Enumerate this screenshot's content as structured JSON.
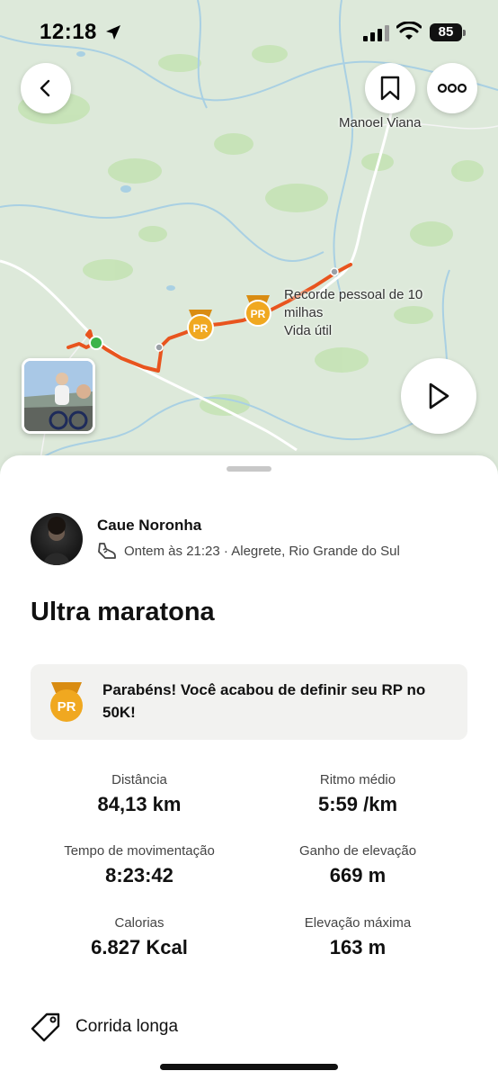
{
  "status_bar": {
    "time": "12:18",
    "battery": "85",
    "icons": [
      "location-arrow-icon",
      "signal-icon",
      "wifi-icon",
      "battery-icon"
    ]
  },
  "map": {
    "town_label": "Manoel Viana",
    "pr_annotation": {
      "line1": "Recorde pessoal de 10",
      "line2": "milhas",
      "line3": "Vida útil"
    },
    "pr_badge_text": "PR",
    "route_color": "#e8541e",
    "icons": [
      "back-arrow-icon",
      "bookmark-icon",
      "more-icon",
      "play-icon"
    ]
  },
  "athlete": {
    "name": "Caue Noronha",
    "meta": "Ontem às 21:23 · Alegrete, Rio Grande do Sul",
    "activity_icon": "running-shoe-icon"
  },
  "activity": {
    "title": "Ultra maratona",
    "pr_message": "Parabéns! Você acabou de definir seu RP no 50K!",
    "pr_badge_text": "PR"
  },
  "stats": [
    {
      "label": "Distância",
      "value": "84,13 km"
    },
    {
      "label": "Ritmo médio",
      "value": "5:59 /km"
    },
    {
      "label": "Tempo de movimentação",
      "value": "8:23:42"
    },
    {
      "label": "Ganho de elevação",
      "value": "669 m"
    },
    {
      "label": "Calorias",
      "value": "6.827 Kcal"
    },
    {
      "label": "Elevação máxima",
      "value": "163 m"
    }
  ],
  "tag": {
    "label": "Corrida longa",
    "icon": "tag-icon"
  },
  "colors": {
    "accent": "#fc4c02",
    "pr_gold": "#f0a820"
  }
}
